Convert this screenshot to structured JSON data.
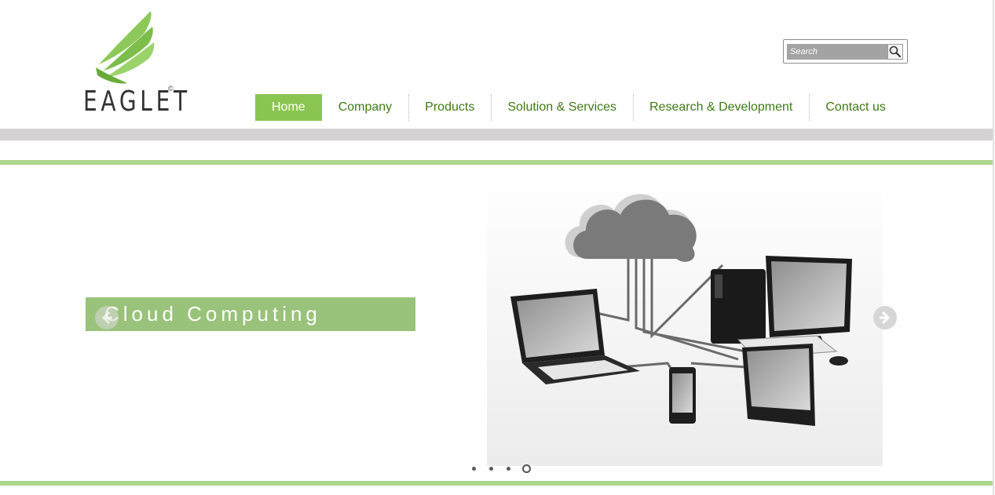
{
  "brand": {
    "logo_text": "EAGLET",
    "copyright_mark": "©"
  },
  "search": {
    "placeholder": "Search"
  },
  "nav": {
    "items": [
      {
        "label": "Home",
        "active": true
      },
      {
        "label": "Company"
      },
      {
        "label": "Products"
      },
      {
        "label": "Solution & Services"
      },
      {
        "label": "Research & Development"
      },
      {
        "label": "Contact us"
      }
    ]
  },
  "slider": {
    "slides": [
      {
        "title": "Cloud Computing"
      }
    ],
    "dot_count": 4,
    "active_dot": 4
  },
  "colors": {
    "accent_green": "#8ac552",
    "nav_text": "#3f7a14",
    "caption_bg": "#99c27a",
    "divider_green": "#acd68c",
    "band_gray": "#d4d2d2"
  },
  "icons": {
    "search": "search-icon",
    "prev": "arrow-left-icon",
    "next": "arrow-right-icon",
    "logo": "eagle-wing-logo"
  }
}
